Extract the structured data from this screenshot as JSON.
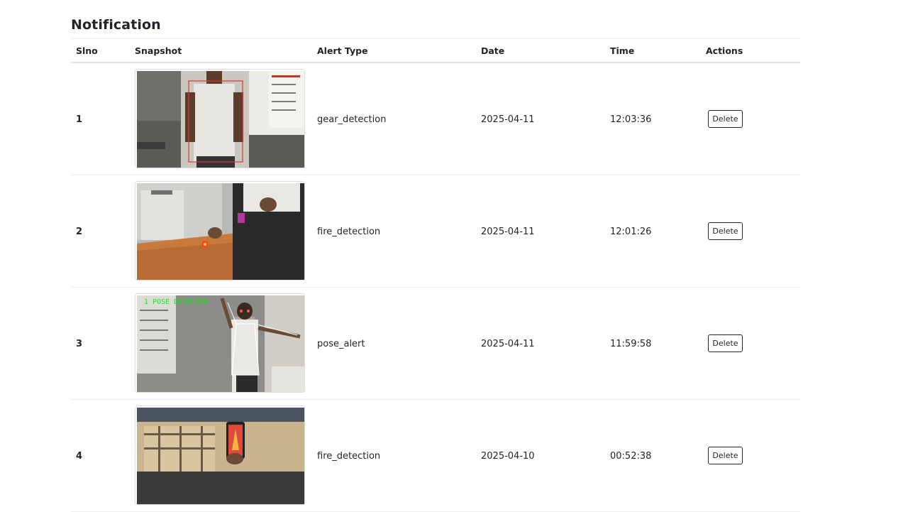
{
  "page": {
    "title": "Notification"
  },
  "table": {
    "headers": {
      "slno": "Slno",
      "snapshot": "Snapshot",
      "alert_type": "Alert Type",
      "date": "Date",
      "time": "Time",
      "actions": "Actions"
    },
    "rows": [
      {
        "slno": "1",
        "alert_type": "gear_detection",
        "date": "2025-04-11",
        "time": "12:03:36",
        "action_label": "Delete"
      },
      {
        "slno": "2",
        "alert_type": "fire_detection",
        "date": "2025-04-11",
        "time": "12:01:26",
        "action_label": "Delete"
      },
      {
        "slno": "3",
        "alert_type": "pose_alert",
        "date": "2025-04-11",
        "time": "11:59:58",
        "action_label": "Delete",
        "overlay_text": "1 POSE DETECTED"
      },
      {
        "slno": "4",
        "alert_type": "fire_detection",
        "date": "2025-04-10",
        "time": "00:52:38",
        "action_label": "Delete"
      }
    ]
  }
}
